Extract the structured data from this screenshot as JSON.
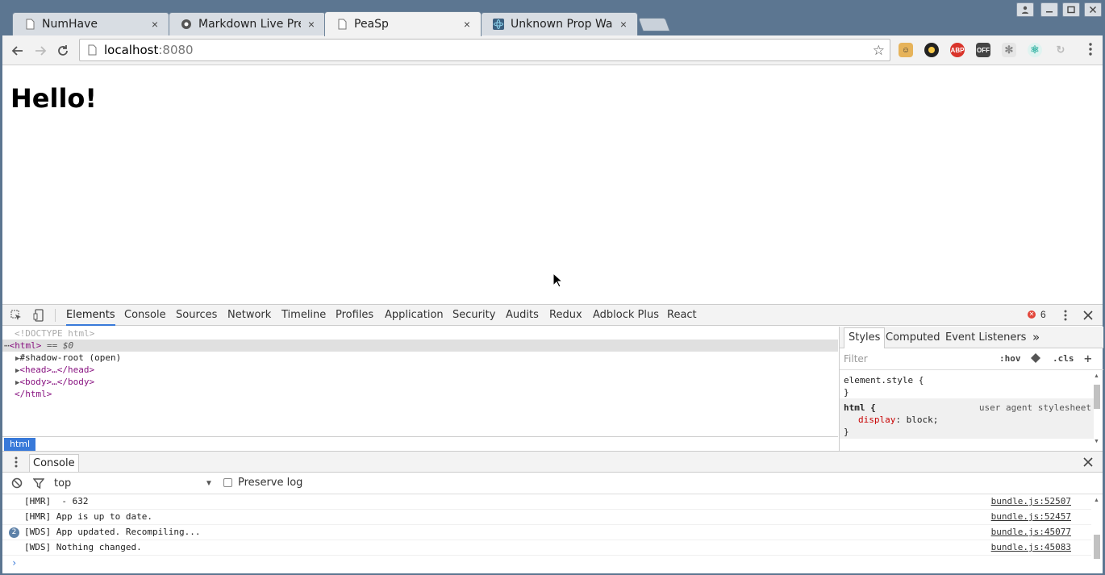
{
  "tabs": [
    {
      "title": "NumHave",
      "icon": "page-icon"
    },
    {
      "title": "Markdown Live Pre",
      "icon": "markdown-icon"
    },
    {
      "title": "PeaSp",
      "icon": "page-icon",
      "active": true
    },
    {
      "title": "Unknown Prop War",
      "icon": "react-icon"
    }
  ],
  "tab_close": "×",
  "toolbar": {
    "url_host": "localhost",
    "url_port": ":8080"
  },
  "page": {
    "heading": "Hello!"
  },
  "devtools": {
    "tabs": [
      "Elements",
      "Console",
      "Sources",
      "Network",
      "Timeline",
      "Profiles",
      "Application",
      "Security",
      "Audits",
      "Redux",
      "Adblock Plus",
      "React"
    ],
    "active_tab": "Elements",
    "error_count": "6",
    "dom": {
      "doctype": "<!DOCTYPE html>",
      "html_open": "<html>",
      "selected_suffix": " == $0",
      "shadow": "#shadow-root (open)",
      "head": "<head>…</head>",
      "body": "<body>…</body>",
      "html_close": "</html>"
    },
    "breadcrumb": "html",
    "styles": {
      "tabs": [
        "Styles",
        "Computed",
        "Event Listeners"
      ],
      "more": "»",
      "filter_placeholder": "Filter",
      "hov": ":hov",
      "cls": ".cls",
      "add": "+",
      "element_style_open": "element.style {",
      "close_brace": "}",
      "html_rule_open": "html {",
      "ua_label": "user agent stylesheet",
      "prop_name": "display",
      "prop_value": ": block;"
    },
    "console": {
      "drawer_tab": "Console",
      "context": "top",
      "preserve_log": "Preserve log",
      "messages": [
        {
          "text": "[HMR]  - 632",
          "source": "bundle.js:52507"
        },
        {
          "text": "[HMR] App is up to date.",
          "source": "bundle.js:52457"
        },
        {
          "text": "[WDS] App updated. Recompiling...",
          "source": "bundle.js:45077",
          "count": "2"
        },
        {
          "text": "[WDS] Nothing changed.",
          "source": "bundle.js:45083"
        }
      ],
      "prompt": "›"
    }
  },
  "colors": {
    "frame": "#5c7691",
    "accent": "#3879d9",
    "error": "#e2453a",
    "tag": "#881280"
  }
}
